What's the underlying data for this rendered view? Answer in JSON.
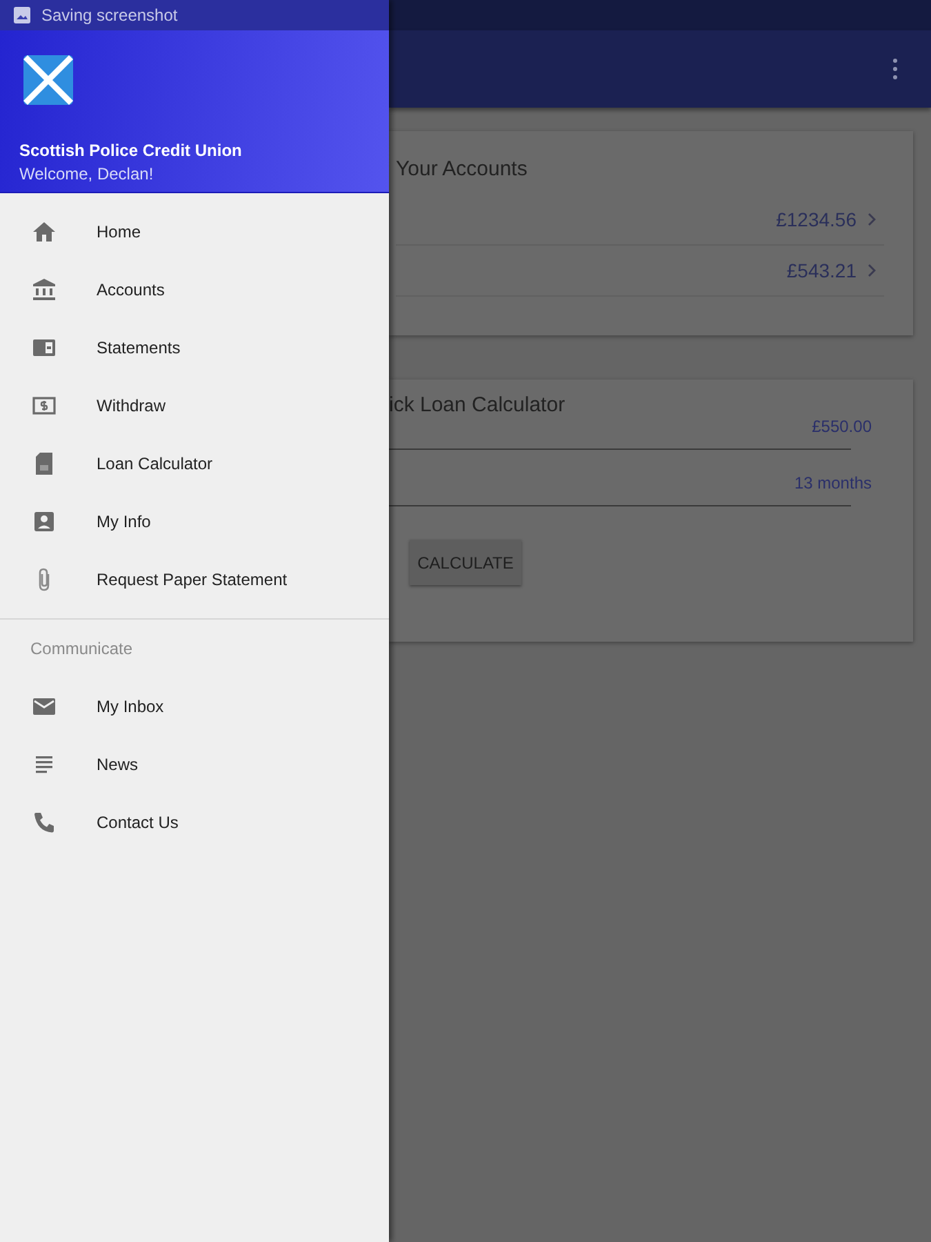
{
  "status_bar": {
    "text": "Saving screenshot"
  },
  "drawer": {
    "title": "Scottish Police Credit Union",
    "subtitle": "Welcome, Declan!",
    "sections": [
      {
        "items": [
          {
            "label": "Home"
          },
          {
            "label": "Accounts"
          },
          {
            "label": "Statements"
          },
          {
            "label": "Withdraw"
          },
          {
            "label": "Loan Calculator"
          },
          {
            "label": "My Info"
          },
          {
            "label": "Request Paper Statement"
          }
        ]
      },
      {
        "header": "Communicate",
        "items": [
          {
            "label": "My Inbox"
          },
          {
            "label": "News"
          },
          {
            "label": "Contact Us"
          }
        ]
      }
    ]
  },
  "accounts_card": {
    "title": "Your Accounts",
    "rows": [
      {
        "balance": "£1234.56"
      },
      {
        "balance": "£543.21"
      }
    ]
  },
  "loan_card": {
    "title": "ick Loan Calculator",
    "amount": "£550.00",
    "term": "13 months",
    "button": "CALCULATE"
  }
}
